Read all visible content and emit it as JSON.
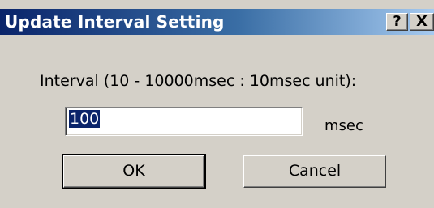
{
  "window": {
    "title": "Update Interval Setting",
    "help_glyph": "?",
    "close_glyph": "X"
  },
  "form": {
    "prompt": "Interval (10 - 10000msec : 10msec unit):",
    "value": "100",
    "unit": "msec"
  },
  "buttons": {
    "ok": "OK",
    "cancel": "Cancel"
  },
  "colors": {
    "titlebar_start": "#0a246a",
    "titlebar_end": "#a6caf0",
    "face": "#d4d0c8",
    "selection": "#0a246a"
  }
}
